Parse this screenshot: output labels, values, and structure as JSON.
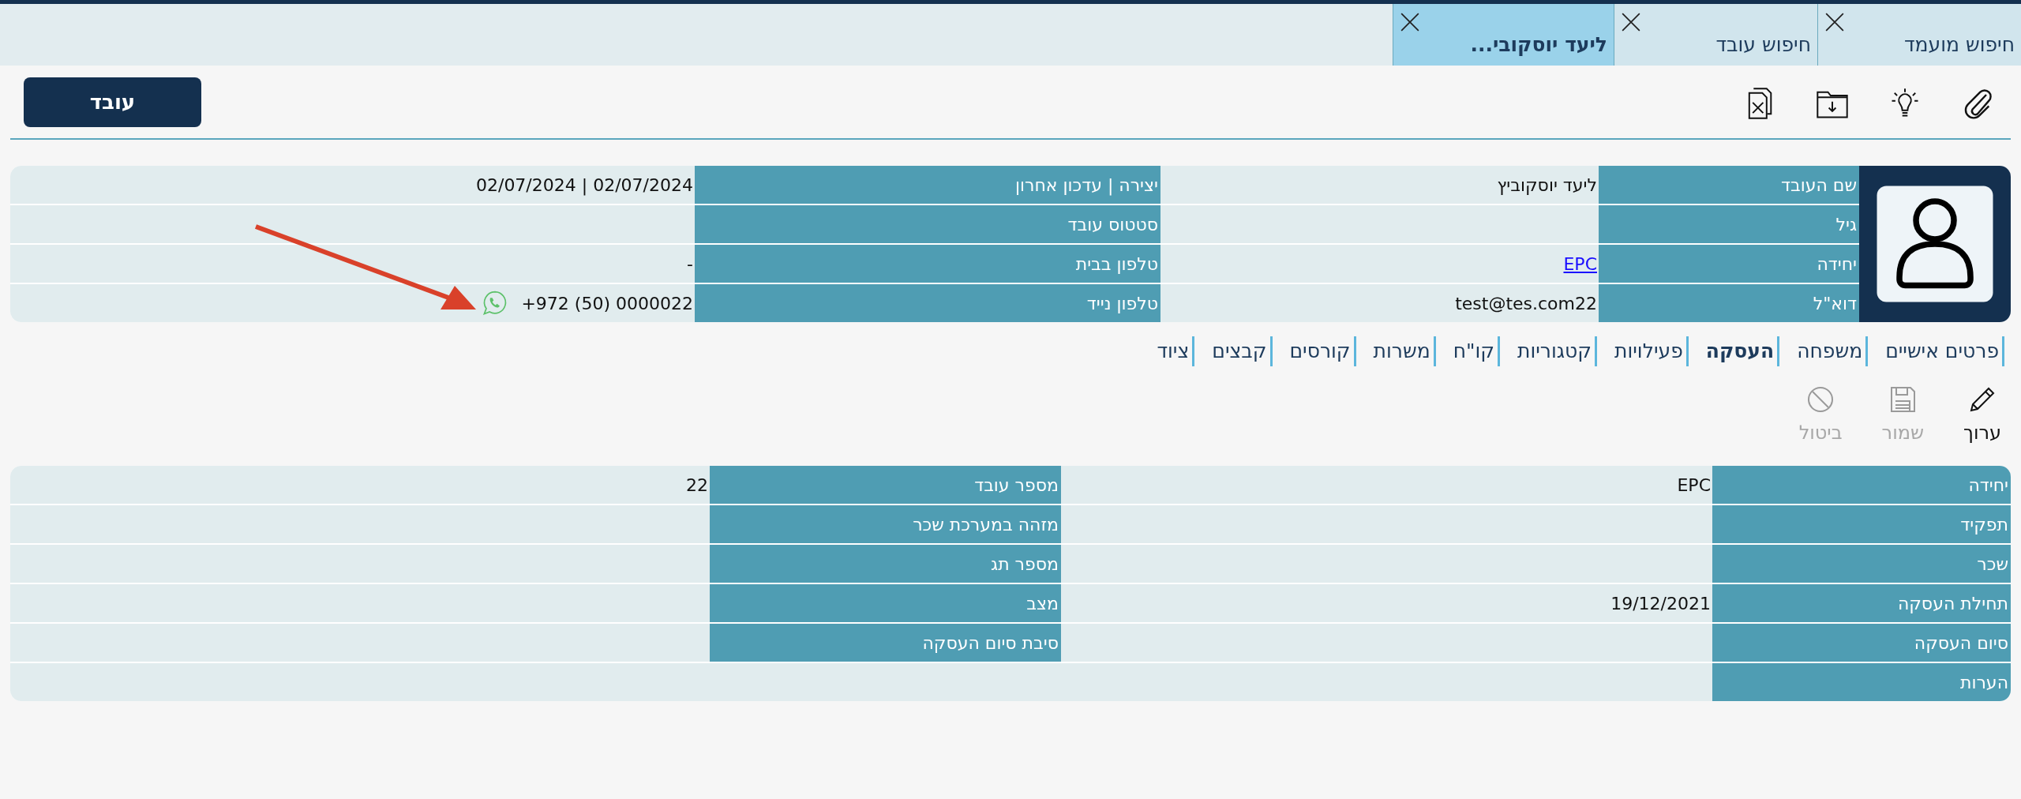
{
  "window_tabs": [
    {
      "label": "חיפוש מועמד",
      "selected": false
    },
    {
      "label": "חיפוש עובד",
      "selected": false
    },
    {
      "label": "ליעד יוסקובי...",
      "selected": true
    }
  ],
  "toolbar": {
    "button": "עובד"
  },
  "header": {
    "rows": [
      {
        "fields": [
          {
            "label": "שם העובד",
            "value": "ליעד יוסקוביץ",
            "kind": "text"
          },
          {
            "label": "יצירה | עדכון אחרון",
            "value": "02/07/2024  |  02/07/2024",
            "kind": "text"
          }
        ]
      },
      {
        "fields": [
          {
            "label": "גיל",
            "kind": "text"
          },
          {
            "label": "סטטוס עובד",
            "kind": "text"
          }
        ]
      },
      {
        "fields": [
          {
            "label": "יחידה",
            "value": "EPC",
            "kind": "link"
          },
          {
            "label": "טלפון בבית",
            "value": "-",
            "kind": "text"
          }
        ]
      },
      {
        "fields": [
          {
            "label": "דוא\"ל",
            "value": "test@tes.com22",
            "kind": "text"
          },
          {
            "label": "טלפון נייד",
            "value": "+972 (50) 0000022",
            "kind": "phone"
          }
        ]
      }
    ]
  },
  "section_tabs": [
    {
      "label": "פרטים אישיים",
      "selected": false
    },
    {
      "label": "משפחה",
      "selected": false
    },
    {
      "label": "העסקה",
      "selected": true
    },
    {
      "label": "פעילויות",
      "selected": false
    },
    {
      "label": "קטגוריות",
      "selected": false
    },
    {
      "label": "קו\"ח",
      "selected": false
    },
    {
      "label": "משרות",
      "selected": false
    },
    {
      "label": "קורסים",
      "selected": false
    },
    {
      "label": "קבצים",
      "selected": false
    },
    {
      "label": "ציוד",
      "selected": false
    }
  ],
  "actions": [
    {
      "label": "ערוך",
      "kind": "edit",
      "disabled": false
    },
    {
      "label": "שמור",
      "kind": "save",
      "disabled": true
    },
    {
      "label": "ביטול",
      "kind": "cancel",
      "disabled": true
    }
  ],
  "employment": {
    "rows": [
      {
        "fields": [
          {
            "label": "יחידה",
            "value": "EPC"
          },
          {
            "label": "מספר עובד",
            "value": "22"
          }
        ]
      },
      {
        "fields": [
          {
            "label": "תפקיד"
          },
          {
            "label": "מזהה במערכת שכר"
          }
        ]
      },
      {
        "fields": [
          {
            "label": "שכר"
          },
          {
            "label": "מספר תג"
          }
        ]
      },
      {
        "fields": [
          {
            "label": "תחילת העסקה",
            "value": "19/12/2021"
          },
          {
            "label": "מצב"
          }
        ]
      },
      {
        "fields": [
          {
            "label": "סיום העסקה"
          },
          {
            "label": "סיבת סיום העסקה"
          }
        ]
      },
      {
        "fields": [
          {
            "label": "הערות"
          }
        ]
      }
    ]
  }
}
